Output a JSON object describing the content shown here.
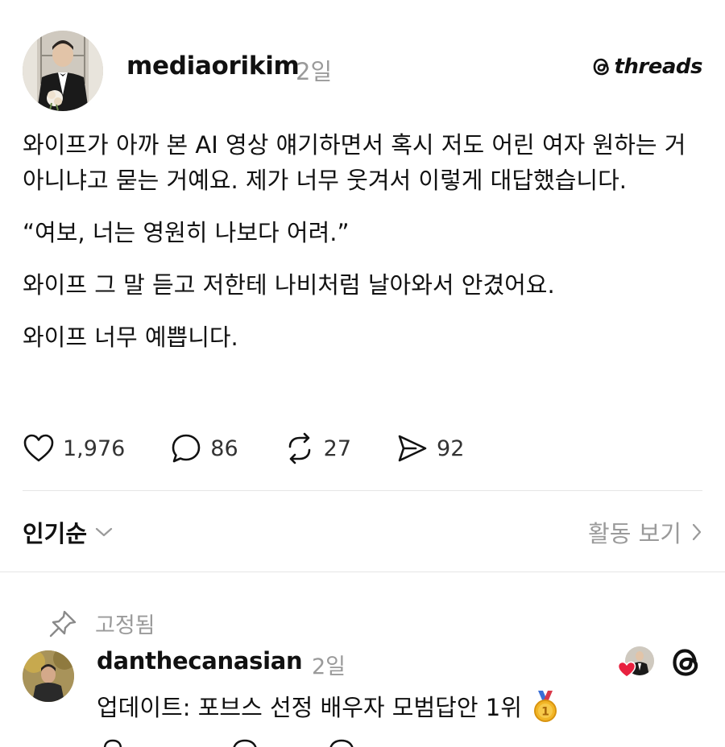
{
  "post": {
    "username": "mediaorikim",
    "time": "2일",
    "brand": "threads",
    "paragraphs": [
      "와이프가 아까 본 AI 영상 얘기하면서 혹시 저도 어린 여자 원하는 거 아니냐고 묻는 거예요. 제가 너무 웃겨서 이렇게 대답했습니다.",
      "“여보, 너는 영원히 나보다 어려.”",
      "와이프 그 말 듣고 저한테 나비처럼 날아와서 안겼어요.",
      "와이프 너무 예쁩니다."
    ],
    "likes": "1,976",
    "comments": "86",
    "reposts": "27",
    "shares": "92"
  },
  "sort": {
    "label": "인기순",
    "activity_label": "활동 보기"
  },
  "pinned": {
    "label": "고정됨"
  },
  "comment": {
    "username": "danthecanasian",
    "time": "2일",
    "text": "업데이트: 포브스 선정 배우자 모범답안 1위",
    "medal_number": "1"
  }
}
